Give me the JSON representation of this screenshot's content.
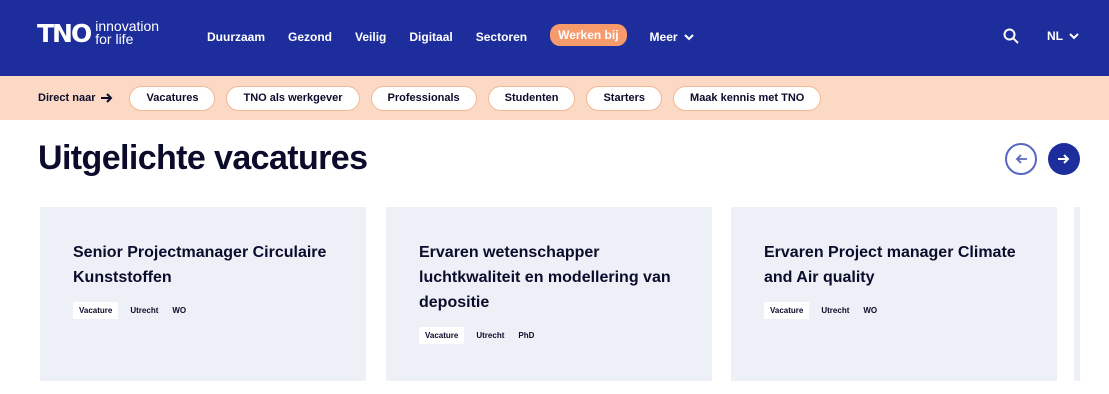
{
  "brand": {
    "logo_text": "TNO",
    "tagline": "innovation for life",
    "primary_color": "#1d2e9c",
    "accent_color": "#f79a6c",
    "subbar_color": "#fcd9c4"
  },
  "nav": {
    "items": [
      {
        "label": "Duurzaam",
        "active": false
      },
      {
        "label": "Gezond",
        "active": false
      },
      {
        "label": "Veilig",
        "active": false
      },
      {
        "label": "Digitaal",
        "active": false
      },
      {
        "label": "Sectoren",
        "active": false
      },
      {
        "label": "Werken bij",
        "active": true
      }
    ],
    "more_label": "Meer",
    "search_icon": "search-icon",
    "language": "NL"
  },
  "subbar": {
    "direct_label": "Direct naar",
    "chips": [
      "Vacatures",
      "TNO als werkgever",
      "Professionals",
      "Studenten",
      "Starters",
      "Maak kennis met TNO"
    ]
  },
  "section": {
    "title": "Uitgelichte vacatures",
    "prev_icon": "arrow-left-icon",
    "next_icon": "arrow-right-icon"
  },
  "vacancies": [
    {
      "title": "Senior Projectmanager Circulaire Kunststoffen",
      "tags": [
        "Vacature",
        "Utrecht",
        "WO"
      ]
    },
    {
      "title": "Ervaren wetenschapper luchtkwaliteit en modellering van depositie",
      "tags": [
        "Vacature",
        "Utrecht",
        "PhD"
      ]
    },
    {
      "title": "Ervaren Project manager Climate and Air quality",
      "tags": [
        "Vacature",
        "Utrecht",
        "WO"
      ]
    }
  ]
}
